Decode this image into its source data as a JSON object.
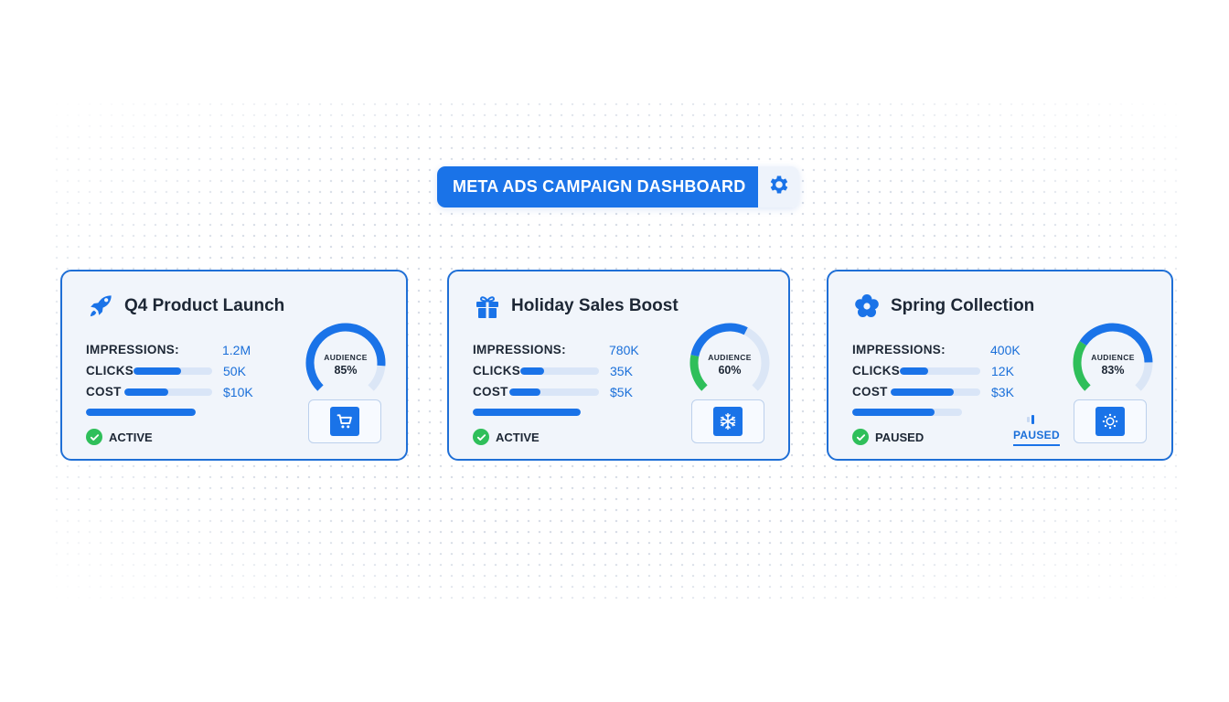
{
  "header": {
    "title": "META ADS CAMPAIGN DASHBOARD",
    "settings_icon": "gear-icon"
  },
  "colors": {
    "accent": "#1a73e8",
    "card_border": "#1f6fd6",
    "card_bg": "#f1f5fb",
    "track": "#d9e5f7",
    "success": "#2fbf5a",
    "text": "#1d2735"
  },
  "labels": {
    "impressions": "IMPRESSIONS:",
    "clicks": "CLICKS",
    "cost": "COST",
    "audience": "AUDIENCE"
  },
  "campaigns": [
    {
      "name": "Q4 Product Launch",
      "icon": "rocket-icon",
      "impressions": "1.2M",
      "clicks": "50K",
      "cost": "$10K",
      "clicks_level": 0.6,
      "cost_level": 0.5,
      "budget_level": 1.0,
      "audience": "85%",
      "audience_level": 0.85,
      "gauge_colors": [
        "#1a73e8",
        "#1a73e8"
      ],
      "status": "ACTIVE",
      "action_icon": "shopping-cart-icon"
    },
    {
      "name": "Holiday Sales Boost",
      "icon": "gift-icon",
      "impressions": "780K",
      "clicks": "35K",
      "cost": "$5K",
      "clicks_level": 0.3,
      "cost_level": 0.35,
      "budget_level": 1.0,
      "audience": "60%",
      "audience_level": 0.6,
      "gauge_colors": [
        "#2fbf5a",
        "#1a73e8"
      ],
      "status": "ACTIVE",
      "action_icon": "snowflake-icon"
    },
    {
      "name": "Spring Collection",
      "icon": "flower-icon",
      "impressions": "400K",
      "clicks": "12K",
      "cost": "$3K",
      "clicks_level": 0.35,
      "cost_level": 0.7,
      "budget_level": 0.75,
      "audience": "83%",
      "audience_level": 0.83,
      "gauge_colors": [
        "#2fbf5a",
        "#1a73e8"
      ],
      "status": "PAUSED",
      "status_tab": "PAUSED",
      "action_icon": "sun-icon"
    }
  ]
}
